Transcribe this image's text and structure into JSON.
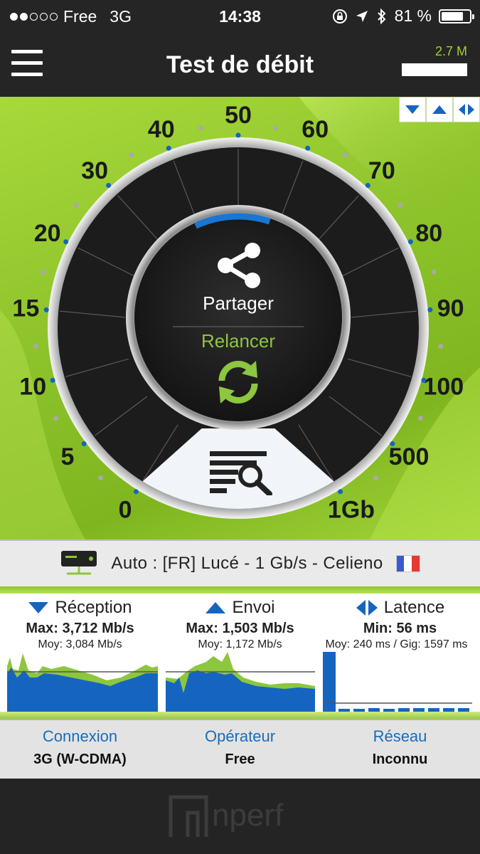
{
  "status": {
    "carrier": "Free",
    "network": "3G",
    "time": "14:38",
    "battery": "81 %"
  },
  "header": {
    "title": "Test de débit",
    "speed": "2.7 M"
  },
  "gauge": {
    "scale": [
      "0",
      "5",
      "10",
      "15",
      "20",
      "30",
      "40",
      "50",
      "60",
      "70",
      "80",
      "90",
      "100",
      "500",
      "1Gb"
    ],
    "share_label": "Partager",
    "restart_label": "Relancer",
    "progress_fraction": 0.12
  },
  "server": {
    "text": "Auto : [FR] Lucé - 1 Gb/s - Celieno"
  },
  "stats": {
    "download": {
      "label": "Réception",
      "max": "Max: 3,712 Mb/s",
      "avg": "Moy: 3,084 Mb/s"
    },
    "upload": {
      "label": "Envoi",
      "max": "Max: 1,503 Mb/s",
      "avg": "Moy: 1,172 Mb/s"
    },
    "latency": {
      "label": "Latence",
      "min": "Min: 56 ms",
      "avg": "Moy: 240 ms / Gig: 1597 ms"
    }
  },
  "info": {
    "connection_label": "Connexion",
    "connection_value": "3G (W-CDMA)",
    "operator_label": "Opérateur",
    "operator_value": "Free",
    "network_label": "Réseau",
    "network_value": "Inconnu"
  },
  "footer": {
    "logo": "nperf"
  },
  "colors": {
    "accent_green": "#8dc63f",
    "accent_blue": "#1a6bb8",
    "dark": "#252525"
  }
}
